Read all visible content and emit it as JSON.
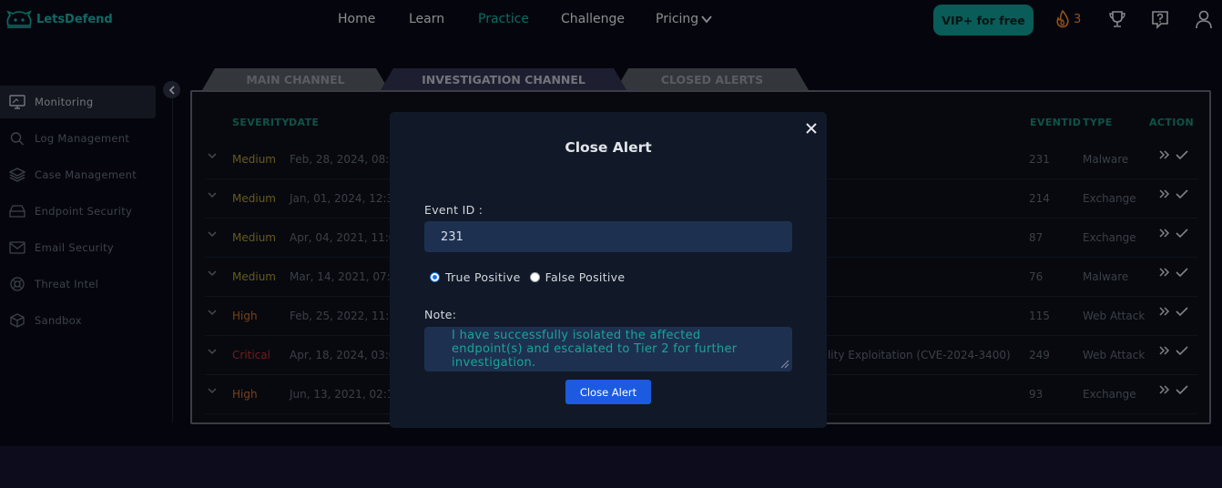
{
  "brand": {
    "name": "LetsDefend"
  },
  "nav": {
    "links": [
      "Home",
      "Learn",
      "Practice",
      "Challenge",
      "Pricing"
    ],
    "active": "Practice",
    "vip_label": "VIP+ for free",
    "streak_count": "3"
  },
  "sidebar": {
    "items": [
      {
        "label": "Monitoring",
        "icon": "monitor-icon"
      },
      {
        "label": "Log Management",
        "icon": "search-icon"
      },
      {
        "label": "Case Management",
        "icon": "layers-icon"
      },
      {
        "label": "Endpoint Security",
        "icon": "drive-icon"
      },
      {
        "label": "Email Security",
        "icon": "mail-icon"
      },
      {
        "label": "Threat Intel",
        "icon": "lifebuoy-icon"
      },
      {
        "label": "Sandbox",
        "icon": "cube-icon"
      }
    ],
    "active": "Monitoring"
  },
  "tabs": [
    "MAIN CHANNEL",
    "INVESTIGATION CHANNEL",
    "CLOSED ALERTS"
  ],
  "active_tab": "INVESTIGATION CHANNEL",
  "table": {
    "headers": {
      "severity": "SEVERITY",
      "date": "DATE",
      "eventid": "EVENTID",
      "type": "TYPE",
      "action": "ACTION"
    },
    "rows": [
      {
        "severity": "Medium",
        "date": "Feb, 28, 2024, 08:",
        "rule": "",
        "eventid": "231",
        "type": "Malware"
      },
      {
        "severity": "Medium",
        "date": "Jan, 01, 2024, 12:3",
        "rule": "",
        "eventid": "214",
        "type": "Exchange"
      },
      {
        "severity": "Medium",
        "date": "Apr, 04, 2021, 11:0",
        "rule": "",
        "eventid": "87",
        "type": "Exchange"
      },
      {
        "severity": "Medium",
        "date": "Mar, 14, 2021, 07:1",
        "rule": "",
        "eventid": "76",
        "type": "Malware"
      },
      {
        "severity": "High",
        "date": "Feb, 25, 2022, 11:3",
        "rule": "",
        "eventid": "115",
        "type": "Web Attack"
      },
      {
        "severity": "Critical",
        "date": "Apr, 18, 2024, 03:0",
        "rule": "bility Exploitation (CVE-2024-3400)",
        "eventid": "249",
        "type": "Web Attack"
      },
      {
        "severity": "High",
        "date": "Jun, 13, 2021, 02:1",
        "rule": "",
        "eventid": "93",
        "type": "Exchange"
      }
    ]
  },
  "modal": {
    "title": "Close Alert",
    "event_id_label": "Event ID :",
    "event_id_value": "231",
    "radio_options": [
      "True Positive",
      "False Positive"
    ],
    "selected": "True Positive",
    "note_label": "Note:",
    "note_value": "I have successfully isolated the affected endpoint(s) and escalated to Tier 2 for further investigation.",
    "submit_label": "Close Alert"
  }
}
